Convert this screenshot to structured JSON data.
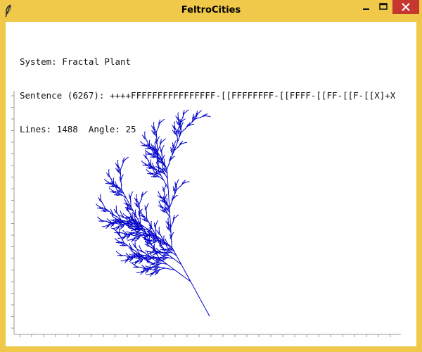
{
  "window": {
    "title": "FeltroCities",
    "icon": "feather-icon",
    "controls": [
      "minimize-icon",
      "maximize-icon",
      "close-icon"
    ]
  },
  "info": {
    "system_line": "System: Fractal Plant",
    "sentence_line": "Sentence (6267): ++++FFFFFFFFFFFFFFFF-[[FFFFFFFF-[[FFFF-[[FF-[[F-[[X]+X",
    "stats_line": "Lines: 1488  Angle: 25"
  },
  "plant": {
    "color": "#0000c8",
    "angle_degrees": 25,
    "line_count": 1488
  }
}
